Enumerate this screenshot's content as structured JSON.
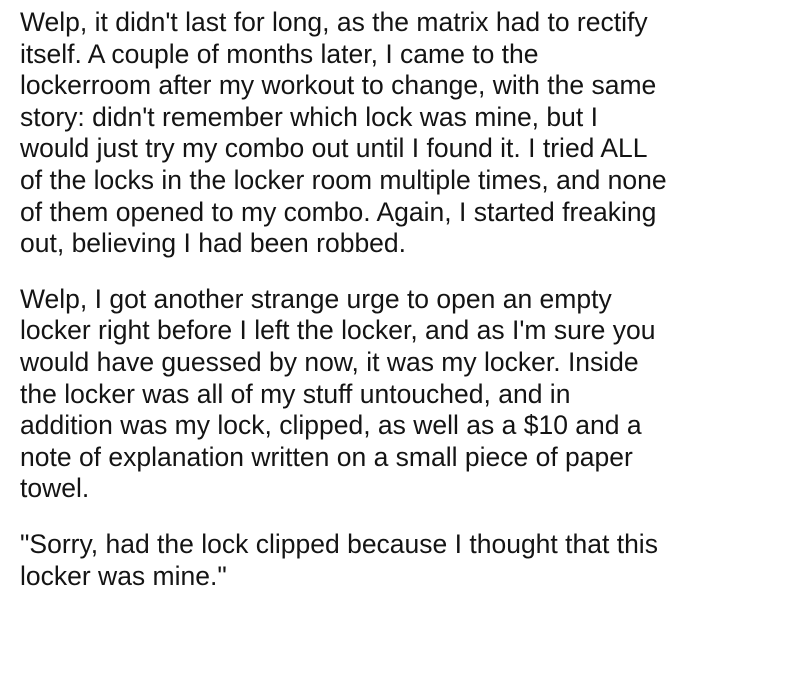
{
  "paragraphs": [
    {
      "lines": [
        "Welp, it didn't last for long, as the matrix had to rectify",
        "itself. A couple of months later, I came to the",
        "lockerroom after my workout to change, with the same",
        "story: didn't remember which lock was mine, but I",
        "would just try my combo out until I found it. I tried ALL",
        "of the locks in the locker room multiple times, and none",
        "of them opened to my combo. Again, I started freaking",
        "out, believing I had been robbed."
      ]
    },
    {
      "lines": [
        "Welp, I got another strange urge to open an empty",
        "locker right before I left the locker, and as I'm sure you",
        "would have guessed by now, it was my locker. Inside",
        "the locker was all of my stuff untouched, and in",
        "addition was my lock, clipped, as well as a $10 and a",
        "note of explanation written on a small piece of paper",
        "towel."
      ]
    },
    {
      "lines": [
        "\"Sorry, had the lock clipped because I thought that this",
        "locker was mine.\""
      ]
    }
  ]
}
